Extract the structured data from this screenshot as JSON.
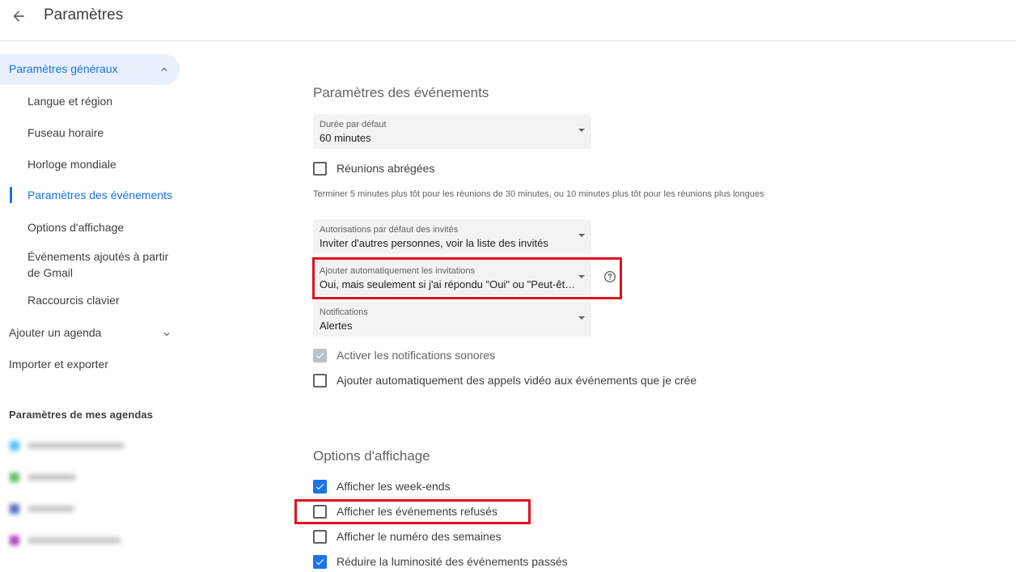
{
  "header": {
    "title": "Paramètres"
  },
  "sidebar": {
    "general_label": "Paramètres généraux",
    "sub_items": [
      {
        "label": "Langue et région"
      },
      {
        "label": "Fuseau horaire"
      },
      {
        "label": "Horloge mondiale"
      },
      {
        "label": "Paramètres des événements"
      },
      {
        "label": "Options d'affichage"
      },
      {
        "label": "Événements ajoutés à partir de Gmail"
      },
      {
        "label": "Raccourcis clavier"
      }
    ],
    "add_calendar": "Ajouter un agenda",
    "import_export": "Importer et exporter",
    "my_calendars_title": "Paramètres de mes agendas",
    "calendar_colors": [
      "#4fc3f7",
      "#66bb6a",
      "#5c6bc0",
      "#ab47bc"
    ]
  },
  "main": {
    "event_settings": {
      "title": "Paramètres des événements",
      "duration": {
        "label": "Durée par défaut",
        "value": "60 minutes"
      },
      "speedy_meetings": {
        "label": "Réunions abrégées",
        "checked": false
      },
      "speedy_desc": "Terminer 5 minutes plus tôt pour les réunions de 30 minutes, ou 10 minutes plus tôt pour les réunions plus longues",
      "guest_permissions": {
        "label": "Autorisations par défaut des invités",
        "value": "Inviter d'autres personnes, voir la liste des invités"
      },
      "auto_add": {
        "label": "Ajouter automatiquement les invitations",
        "value": "Oui, mais seulement si j'ai répondu \"Oui\" ou \"Peut-être\""
      },
      "notifications": {
        "label": "Notifications",
        "value": "Alertes"
      },
      "sound": {
        "label": "Activer les notifications sonores",
        "checked": true,
        "disabled": true
      },
      "video_calls": {
        "label": "Ajouter automatiquement des appels vidéo aux événements que je crée",
        "checked": false
      }
    },
    "view_options": {
      "title": "Options d'affichage",
      "weekends": {
        "label": "Afficher les week-ends",
        "checked": true
      },
      "declined": {
        "label": "Afficher les événements refusés",
        "checked": false
      },
      "week_numbers": {
        "label": "Afficher le numéro des semaines",
        "checked": false
      },
      "dim_past": {
        "label": "Réduire la luminosité des événements passés",
        "checked": true
      }
    }
  },
  "colors": {
    "accent": "#1a73e8",
    "highlight_box": "#e0121f"
  }
}
